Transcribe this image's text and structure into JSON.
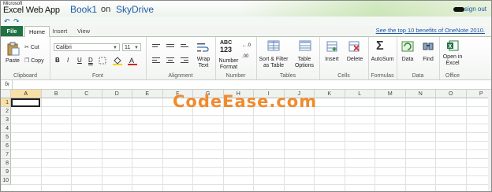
{
  "title": {
    "vendor": "Microsoft",
    "app": "Excel Web App",
    "doc": "Book1",
    "on": "on",
    "location": "SkyDrive",
    "signout": "sign out"
  },
  "qat": {
    "undo_icon": "undo-icon",
    "redo_icon": "redo-icon"
  },
  "tabs": [
    "File",
    "Home",
    "Insert",
    "View"
  ],
  "promo": "See the top 10 benefits of OneNote 2010.",
  "ribbon": {
    "clipboard": {
      "paste": "Paste",
      "cut": "Cut",
      "copy": "Copy",
      "label": "Clipboard"
    },
    "font": {
      "name": "Calibri",
      "size": "11",
      "bold": "B",
      "italic": "I",
      "underline": "U",
      "double_underline": "D",
      "label": "Font"
    },
    "alignment": {
      "wrap": "Wrap Text",
      "label": "Alignment"
    },
    "number": {
      "abc": "ABC",
      "num": "123",
      "format": "Number Format",
      "label": "Number"
    },
    "tables": {
      "sort": "Sort & Filter as Table",
      "options": "Table Options",
      "label": "Tables"
    },
    "cells": {
      "insert": "Insert",
      "delete": "Delete",
      "label": "Cells"
    },
    "formulas": {
      "autosum": "AutoSum",
      "label": "Formulas"
    },
    "data": {
      "data": "Data",
      "find": "Find",
      "label": "Data"
    },
    "office": {
      "open": "Open in Excel",
      "label": "Office"
    }
  },
  "formula_bar": {
    "fx": "fx",
    "value": ""
  },
  "columns": [
    "A",
    "B",
    "C",
    "D",
    "E",
    "F",
    "G",
    "H",
    "I",
    "J",
    "K",
    "L",
    "M",
    "N",
    "O",
    "P"
  ],
  "rows": [
    "1",
    "2",
    "3",
    "4",
    "5",
    "6",
    "7",
    "8",
    "9",
    "10"
  ],
  "active_cell": "A1",
  "watermark": "CodeEase.com",
  "colors": {
    "file_tab": "#207245",
    "link": "#1a56a8",
    "selected_header": "#f9e1a6",
    "watermark": "#f08b2e"
  }
}
